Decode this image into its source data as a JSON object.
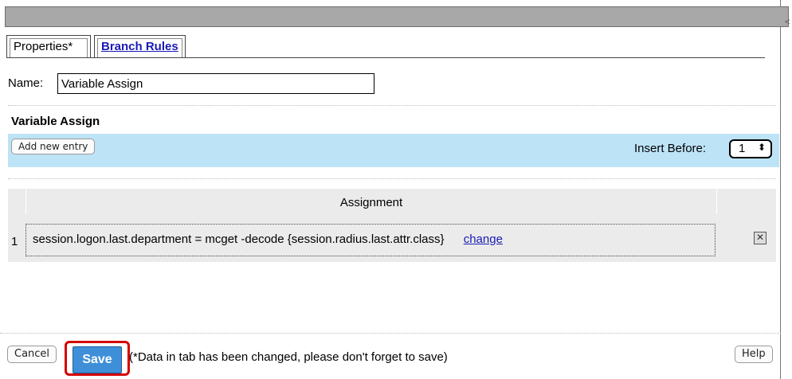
{
  "tabs": [
    {
      "label": "Properties*"
    },
    {
      "label": "Branch Rules"
    }
  ],
  "name_field": {
    "label": "Name:",
    "value": "Variable Assign"
  },
  "section": {
    "title": "Variable Assign"
  },
  "toolbar": {
    "add_label": "Add new entry",
    "insert_label": "Insert Before:",
    "insert_value": "1",
    "insert_chevron": "⬍"
  },
  "table": {
    "header": "Assignment",
    "rows": [
      {
        "num": "1",
        "expression": "session.logon.last.department = mcget -decode {session.radius.last.attr.class}",
        "action": "change",
        "delete": "✕"
      }
    ]
  },
  "footer": {
    "cancel": "Cancel",
    "save": "Save",
    "note": "(*Data in tab has been changed, please don't forget to save)",
    "help": "Help"
  },
  "edge_glyph": "<",
  "colors": {
    "titlebar": "#a8a8a8",
    "toolbar": "#bde3f7",
    "save": "#3f8fd8",
    "highlight": "#d40000",
    "link": "#1a1ab5"
  }
}
